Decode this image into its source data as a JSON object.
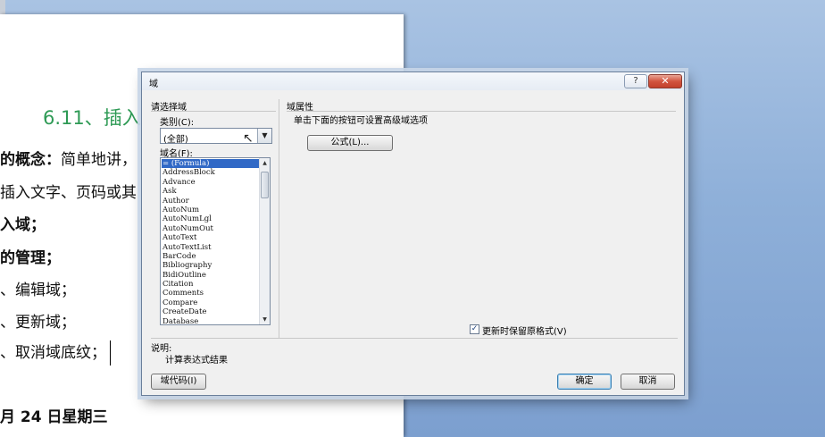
{
  "document": {
    "title": "6.11、插入",
    "lines": [
      {
        "bold": "的概念：",
        "text": "简单地讲，"
      },
      {
        "bold": "",
        "text": "插入文字、页码或其"
      },
      {
        "bold": "入域；",
        "text": ""
      },
      {
        "bold": "的管理；",
        "text": ""
      },
      {
        "bold": "",
        "text": "、编辑域；"
      },
      {
        "bold": "",
        "text": "、更新域；"
      },
      {
        "bold": "",
        "text": "、取消域底纹；"
      },
      {
        "bold": "月 24 日星期三",
        "text": ""
      }
    ]
  },
  "dialog": {
    "title": "域",
    "help_label": "?",
    "close_label": "✕",
    "choose_field_label": "请选择域",
    "category_label": "类别(C):",
    "category_value": "(全部)",
    "field_names_label": "域名(F):",
    "field_names": [
      "= (Formula)",
      "AddressBlock",
      "Advance",
      "Ask",
      "Author",
      "AutoNum",
      "AutoNumLgl",
      "AutoNumOut",
      "AutoText",
      "AutoTextList",
      "BarCode",
      "Bibliography",
      "BidiOutline",
      "Citation",
      "Comments",
      "Compare",
      "CreateDate",
      "Database"
    ],
    "selected_field_index": 0,
    "field_properties_label": "域属性",
    "field_properties_hint": "单击下面的按钮可设置高级域选项",
    "formula_button": "公式(L)...",
    "preserve_format_label": "更新时保留原格式(V)",
    "preserve_format_checked": "✓",
    "description_label": "说明:",
    "description_text": "计算表达式结果",
    "field_codes_button": "域代码(I)",
    "ok_button": "确定",
    "cancel_button": "取消"
  }
}
